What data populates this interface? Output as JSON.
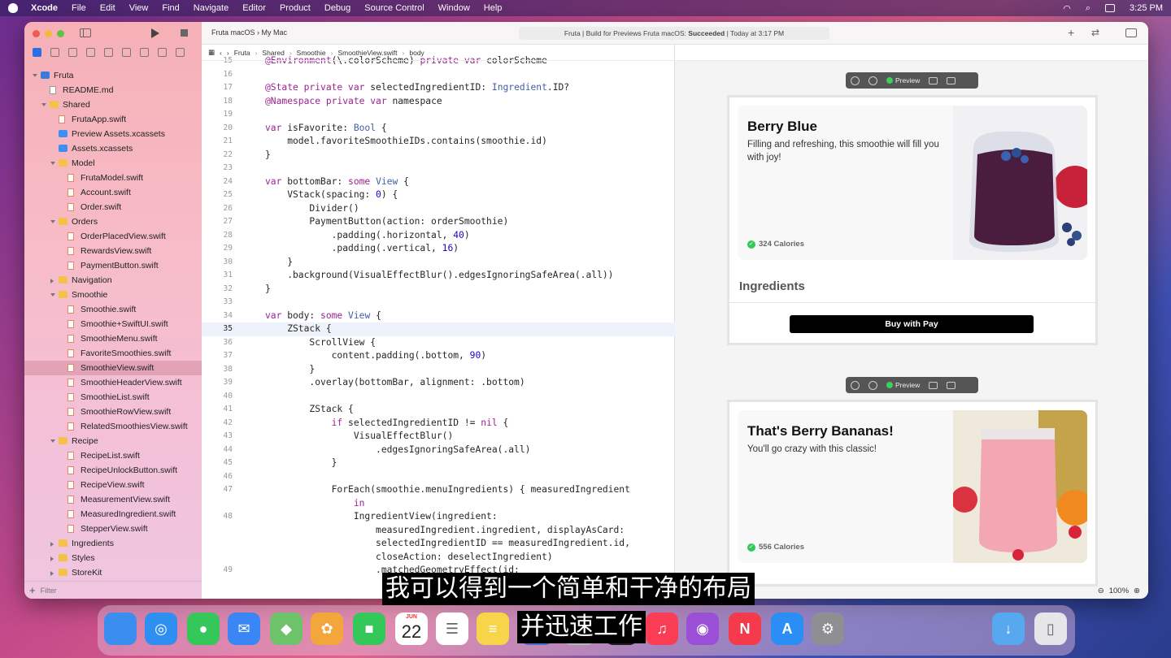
{
  "menubar": {
    "app": "Xcode",
    "items": [
      "File",
      "Edit",
      "View",
      "Find",
      "Navigate",
      "Editor",
      "Product",
      "Debug",
      "Source Control",
      "Window",
      "Help"
    ],
    "clock": "3:25 PM"
  },
  "toolbar": {
    "scheme": "Fruta macOS",
    "destination": "My Mac",
    "status_prefix": "Fruta | Build for Previews Fruta macOS:",
    "status_result": "Succeeded",
    "status_time": "| Today at 3:17 PM"
  },
  "jumpbar": [
    "Fruta",
    "Shared",
    "Smoothie",
    "SmoothieView.swift",
    "body"
  ],
  "navigator": {
    "tree": [
      {
        "label": "Fruta",
        "depth": 0,
        "kind": "proj",
        "disc": "open"
      },
      {
        "label": "README.md",
        "depth": 1,
        "kind": "doc"
      },
      {
        "label": "Shared",
        "depth": 1,
        "kind": "folder",
        "disc": "open"
      },
      {
        "label": "FrutaApp.swift",
        "depth": 2,
        "kind": "file"
      },
      {
        "label": "Preview Assets.xcassets",
        "depth": 2,
        "kind": "assets"
      },
      {
        "label": "Assets.xcassets",
        "depth": 2,
        "kind": "assets"
      },
      {
        "label": "Model",
        "depth": 2,
        "kind": "folder",
        "disc": "open"
      },
      {
        "label": "FrutaModel.swift",
        "depth": 3,
        "kind": "file"
      },
      {
        "label": "Account.swift",
        "depth": 3,
        "kind": "file"
      },
      {
        "label": "Order.swift",
        "depth": 3,
        "kind": "file"
      },
      {
        "label": "Orders",
        "depth": 2,
        "kind": "folder",
        "disc": "open"
      },
      {
        "label": "OrderPlacedView.swift",
        "depth": 3,
        "kind": "file"
      },
      {
        "label": "RewardsView.swift",
        "depth": 3,
        "kind": "file"
      },
      {
        "label": "PaymentButton.swift",
        "depth": 3,
        "kind": "file"
      },
      {
        "label": "Navigation",
        "depth": 2,
        "kind": "folder",
        "disc": "closed"
      },
      {
        "label": "Smoothie",
        "depth": 2,
        "kind": "folder",
        "disc": "open"
      },
      {
        "label": "Smoothie.swift",
        "depth": 3,
        "kind": "file"
      },
      {
        "label": "Smoothie+SwiftUI.swift",
        "depth": 3,
        "kind": "file"
      },
      {
        "label": "SmoothieMenu.swift",
        "depth": 3,
        "kind": "file"
      },
      {
        "label": "FavoriteSmoothies.swift",
        "depth": 3,
        "kind": "file"
      },
      {
        "label": "SmoothieView.swift",
        "depth": 3,
        "kind": "file",
        "selected": true
      },
      {
        "label": "SmoothieHeaderView.swift",
        "depth": 3,
        "kind": "file"
      },
      {
        "label": "SmoothieList.swift",
        "depth": 3,
        "kind": "file"
      },
      {
        "label": "SmoothieRowView.swift",
        "depth": 3,
        "kind": "file"
      },
      {
        "label": "RelatedSmoothiesView.swift",
        "depth": 3,
        "kind": "file"
      },
      {
        "label": "Recipe",
        "depth": 2,
        "kind": "folder",
        "disc": "open"
      },
      {
        "label": "RecipeList.swift",
        "depth": 3,
        "kind": "file"
      },
      {
        "label": "RecipeUnlockButton.swift",
        "depth": 3,
        "kind": "file"
      },
      {
        "label": "RecipeView.swift",
        "depth": 3,
        "kind": "file"
      },
      {
        "label": "MeasurementView.swift",
        "depth": 3,
        "kind": "file"
      },
      {
        "label": "MeasuredIngredient.swift",
        "depth": 3,
        "kind": "file"
      },
      {
        "label": "StepperView.swift",
        "depth": 3,
        "kind": "file"
      },
      {
        "label": "Ingredients",
        "depth": 2,
        "kind": "folder",
        "disc": "closed"
      },
      {
        "label": "Styles",
        "depth": 2,
        "kind": "folder",
        "disc": "closed"
      },
      {
        "label": "StoreKit",
        "depth": 2,
        "kind": "folder",
        "disc": "closed"
      }
    ],
    "filter_placeholder": "Filter"
  },
  "editor": {
    "current_line": "35",
    "lines": [
      {
        "n": "15",
        "t": "@Environment(\\.colorScheme) private var colorScheme"
      },
      {
        "n": "16",
        "t": ""
      },
      {
        "n": "17",
        "t": "@State private var selectedIngredientID: Ingredient.ID?"
      },
      {
        "n": "18",
        "t": "@Namespace private var namespace"
      },
      {
        "n": "19",
        "t": ""
      },
      {
        "n": "20",
        "t": "var isFavorite: Bool {"
      },
      {
        "n": "21",
        "t": "    model.favoriteSmoothieIDs.contains(smoothie.id)"
      },
      {
        "n": "22",
        "t": "}"
      },
      {
        "n": "23",
        "t": ""
      },
      {
        "n": "24",
        "t": "var bottomBar: some View {"
      },
      {
        "n": "25",
        "t": "    VStack(spacing: 0) {"
      },
      {
        "n": "26",
        "t": "        Divider()"
      },
      {
        "n": "27",
        "t": "        PaymentButton(action: orderSmoothie)"
      },
      {
        "n": "28",
        "t": "            .padding(.horizontal, 40)"
      },
      {
        "n": "29",
        "t": "            .padding(.vertical, 16)"
      },
      {
        "n": "30",
        "t": "    }"
      },
      {
        "n": "31",
        "t": "    .background(VisualEffectBlur().edgesIgnoringSafeArea(.all))"
      },
      {
        "n": "32",
        "t": "}"
      },
      {
        "n": "33",
        "t": ""
      },
      {
        "n": "34",
        "t": "var body: some View {"
      },
      {
        "n": "35",
        "t": "    ZStack {"
      },
      {
        "n": "36",
        "t": "        ScrollView {"
      },
      {
        "n": "37",
        "t": "            content.padding(.bottom, 90)"
      },
      {
        "n": "38",
        "t": "        }"
      },
      {
        "n": "39",
        "t": "        .overlay(bottomBar, alignment: .bottom)"
      },
      {
        "n": "40",
        "t": ""
      },
      {
        "n": "41",
        "t": "        ZStack {"
      },
      {
        "n": "42",
        "t": "            if selectedIngredientID != nil {"
      },
      {
        "n": "43",
        "t": "                VisualEffectBlur()"
      },
      {
        "n": "44",
        "t": "                    .edgesIgnoringSafeArea(.all)"
      },
      {
        "n": "45",
        "t": "            }"
      },
      {
        "n": "46",
        "t": ""
      },
      {
        "n": "47",
        "t": "            ForEach(smoothie.menuIngredients) { measuredIngredient"
      },
      {
        "n": "",
        "t": "                in"
      },
      {
        "n": "48",
        "t": "                IngredientView(ingredient:"
      },
      {
        "n": "",
        "t": "                    measuredIngredient.ingredient, displayAsCard:"
      },
      {
        "n": "",
        "t": "                    selectedIngredientID == measuredIngredient.id,"
      },
      {
        "n": "",
        "t": "                    closeAction: deselectIngredient)"
      },
      {
        "n": "49",
        "t": "                    .matchedGeometryEffect(id:"
      }
    ]
  },
  "previews": [
    {
      "live_label": "Preview",
      "title": "Berry Blue",
      "description": "Filling and refreshing, this smoothie will fill you with joy!",
      "calories": "324 Calories",
      "section": "Ingredients",
      "pay_label": "Buy with  Pay"
    },
    {
      "live_label": "Preview",
      "title": "That's Berry Bananas!",
      "description": "You'll go crazy with this classic!",
      "calories": "556 Calories"
    }
  ],
  "canvas": {
    "zoom": "100%"
  },
  "dock": {
    "calendar_month": "JUN",
    "calendar_day": "22",
    "apps": [
      {
        "name": "finder-icon",
        "color": "#3b8ef0",
        "glyph": ""
      },
      {
        "name": "safari-icon",
        "color": "#2f8ff0",
        "glyph": "◎"
      },
      {
        "name": "messages-icon",
        "color": "#35c759",
        "glyph": "●"
      },
      {
        "name": "mail-icon",
        "color": "#3a86f5",
        "glyph": "✉"
      },
      {
        "name": "maps-icon",
        "color": "#6ec26a",
        "glyph": "◆"
      },
      {
        "name": "photos-icon",
        "color": "#f3a73b",
        "glyph": "✿"
      },
      {
        "name": "facetime-icon",
        "color": "#34c759",
        "glyph": "■"
      },
      {
        "name": "calendar-icon",
        "color": "#ffffff",
        "glyph": ""
      },
      {
        "name": "reminders-icon",
        "color": "#ffffff",
        "glyph": "☰"
      },
      {
        "name": "notes-icon",
        "color": "#f7d54a",
        "glyph": "≡"
      },
      {
        "name": "xcode-instruments-icon",
        "color": "#4a6dc9",
        "glyph": "⚒"
      },
      {
        "name": "reality-composer-icon",
        "color": "#b8b8b8",
        "glyph": "⬡"
      },
      {
        "name": "apple-tv-icon",
        "color": "#1c1c1e",
        "glyph": "tv"
      },
      {
        "name": "music-icon",
        "color": "#fa3c55",
        "glyph": "♫"
      },
      {
        "name": "podcasts-icon",
        "color": "#9a4fd6",
        "glyph": "◉"
      },
      {
        "name": "news-icon",
        "color": "#f53a4c",
        "glyph": "N"
      },
      {
        "name": "app-store-icon",
        "color": "#2a8ef5",
        "glyph": "A"
      },
      {
        "name": "system-preferences-icon",
        "color": "#8e8e93",
        "glyph": "⚙"
      },
      {
        "name": "downloads-folder-icon",
        "color": "#57a8ef",
        "glyph": "↓"
      },
      {
        "name": "trash-icon",
        "color": "#e5e5ea",
        "glyph": "▯"
      }
    ]
  },
  "subtitles": {
    "line1": "我可以得到一个简单和干净的布局",
    "line2": "并迅速工作"
  }
}
